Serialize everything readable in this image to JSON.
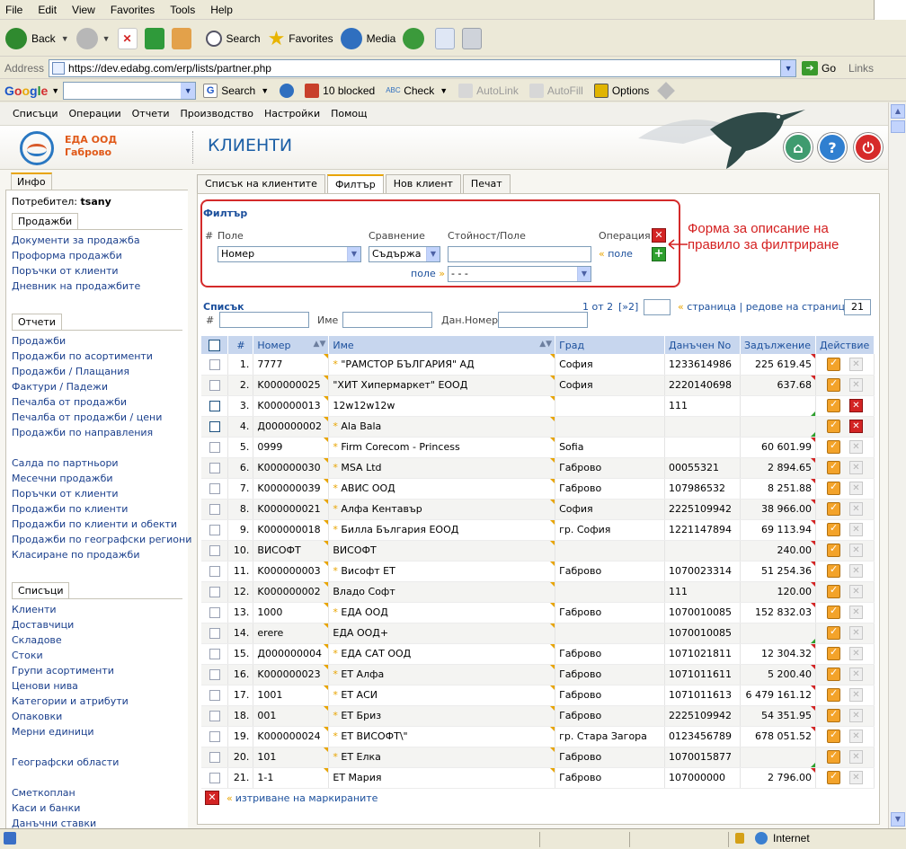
{
  "browser": {
    "menu": [
      "File",
      "Edit",
      "View",
      "Favorites",
      "Tools",
      "Help"
    ],
    "toolbar": {
      "back": "Back",
      "search": "Search",
      "favorites": "Favorites",
      "media": "Media"
    },
    "address": {
      "label": "Address",
      "url": "https://dev.edabg.com/erp/lists/partner.php",
      "go": "Go",
      "links": "Links"
    },
    "googlebar": {
      "search": "Search",
      "blocked": "10 blocked",
      "check": "Check",
      "autolink": "AutoLink",
      "autofill": "AutoFill",
      "options": "Options"
    },
    "status": {
      "zone": "Internet"
    }
  },
  "app": {
    "menu": [
      "Списъци",
      "Операции",
      "Отчети",
      "Производство",
      "Настройки",
      "Помощ"
    ],
    "company": {
      "line1": "ЕДА ООД",
      "line2": "Габрово"
    },
    "title": "КЛИЕНТИ",
    "header_buttons": {
      "home": "⌂",
      "help": "?",
      "power": "⏻"
    }
  },
  "sidebar": {
    "info_tab": "Инфо",
    "user_label": "Потребител:",
    "user_name": "tsany",
    "sections": [
      {
        "title": "Продажби",
        "links": [
          "Документи за продажба",
          "Проформа продажби",
          "Поръчки от клиенти",
          "Дневник на продажбите"
        ]
      },
      {
        "title": "Отчети",
        "links": [
          "Продажби",
          "Продажби по асортименти",
          "Продажби / Плащания",
          "Фактури / Падежи",
          "Печалба от продажби",
          "Печалба от продажби / цени",
          "Продажби по направления",
          "",
          "Салда по партньори",
          "Месечни продажби",
          "Поръчки от клиенти",
          "Продажби по клиенти",
          "Продажби по клиенти и обекти",
          "Продажби по географски региони",
          "Класиране по продажби"
        ]
      },
      {
        "title": "Списъци",
        "links": [
          "Клиенти",
          "Доставчици",
          "Складове",
          "Стоки",
          "Групи асортименти",
          "Ценови нива",
          "Категории и атрибути",
          "Опаковки",
          "Мерни единици",
          "",
          "Географски области",
          "",
          "Сметкоплан",
          "Каси и банки",
          "Данъчни ставки"
        ]
      }
    ]
  },
  "tabs": [
    "Списък на клиентите",
    "Филтър",
    "Нов клиент",
    "Печат"
  ],
  "filter": {
    "title": "Филтър",
    "col_hash": "#",
    "col_field": "Поле",
    "col_compare": "Сравнение",
    "col_value": "Стойност/Поле",
    "col_operation": "Операция",
    "field_value": "Номер",
    "compare_value": "Съдържа",
    "value_input": "",
    "field_link": "поле",
    "field2_label": "поле",
    "field2_value": "- - -",
    "annotation": "Форма за описание на правило за филтриране"
  },
  "list": {
    "title": "Списък",
    "pager_text": "1 от 2",
    "pager_next": "[»2]",
    "page_input": "",
    "page_link": "страница",
    "rows_link": "редове на страница",
    "rows_value": "21",
    "search": {
      "hash_label": "#",
      "name_label": "Име",
      "tax_label": "Дан.Номер"
    },
    "columns": [
      "#",
      "Номер",
      "Име",
      "Град",
      "Данъчен No",
      "Задължение",
      "Действие"
    ],
    "rows": [
      {
        "n": "1.",
        "number": "7777",
        "star": true,
        "name": "\"РАМСТОР БЪЛГАРИЯ\" АД",
        "city": "София",
        "tax": "1233614986",
        "debt": "225 619.45",
        "del_red": false,
        "blue_cb": false
      },
      {
        "n": "2.",
        "number": "K000000025",
        "star": false,
        "name": "\"ХИТ Хипермаркет\" ЕООД",
        "city": "София",
        "tax": "2220140698",
        "debt": "637.68",
        "del_red": false,
        "blue_cb": false
      },
      {
        "n": "3.",
        "number": "K000000013",
        "star": false,
        "name": "12w12w12w",
        "city": "",
        "tax": "111",
        "debt": "",
        "del_red": true,
        "blue_cb": true
      },
      {
        "n": "4.",
        "number": "Д000000002",
        "star": true,
        "name": "Ala Bala",
        "city": "",
        "tax": "",
        "debt": "",
        "del_red": true,
        "blue_cb": true
      },
      {
        "n": "5.",
        "number": "0999",
        "star": true,
        "name": "Firm Corecom - Princess",
        "city": "Sofia",
        "tax": "",
        "debt": "60 601.99",
        "del_red": false,
        "blue_cb": false
      },
      {
        "n": "6.",
        "number": "K000000030",
        "star": true,
        "name": "MSA Ltd",
        "city": "Габрово",
        "tax": "00055321",
        "debt": "2 894.65",
        "del_red": false,
        "blue_cb": false
      },
      {
        "n": "7.",
        "number": "K000000039",
        "star": true,
        "name": "АВИС ООД",
        "city": "Габрово",
        "tax": "107986532",
        "debt": "8 251.88",
        "del_red": false,
        "blue_cb": false
      },
      {
        "n": "8.",
        "number": "K000000021",
        "star": true,
        "name": "Алфа Кентавър",
        "city": "София",
        "tax": "2225109942",
        "debt": "38 966.00",
        "del_red": false,
        "blue_cb": false
      },
      {
        "n": "9.",
        "number": "K000000018",
        "star": true,
        "name": "Билла България ЕООД",
        "city": "гр. София",
        "tax": "1221147894",
        "debt": "69 113.94",
        "del_red": false,
        "blue_cb": false
      },
      {
        "n": "10.",
        "number": "ВИСОФТ",
        "star": false,
        "name": "ВИСОФТ",
        "city": "",
        "tax": "",
        "debt": "240.00",
        "del_red": false,
        "blue_cb": false
      },
      {
        "n": "11.",
        "number": "K000000003",
        "star": true,
        "name": "Висофт ЕТ",
        "city": "Габрово",
        "tax": "1070023314",
        "debt": "51 254.36",
        "del_red": false,
        "blue_cb": false
      },
      {
        "n": "12.",
        "number": "K000000002",
        "star": false,
        "name": "Владо Софт",
        "city": "",
        "tax": "111",
        "debt": "120.00",
        "del_red": false,
        "blue_cb": false
      },
      {
        "n": "13.",
        "number": "1000",
        "star": true,
        "name": "ЕДА ООД",
        "city": "Габрово",
        "tax": "1070010085",
        "debt": "152 832.03",
        "del_red": false,
        "blue_cb": false
      },
      {
        "n": "14.",
        "number": "erere",
        "star": false,
        "name": "ЕДА ООД+",
        "city": "",
        "tax": "1070010085",
        "debt": "",
        "del_red": false,
        "blue_cb": false
      },
      {
        "n": "15.",
        "number": "Д000000004",
        "star": true,
        "name": "ЕДА САТ ООД",
        "city": "Габрово",
        "tax": "1071021811",
        "debt": "12 304.32",
        "del_red": false,
        "blue_cb": false
      },
      {
        "n": "16.",
        "number": "K000000023",
        "star": true,
        "name": "ЕТ Алфа",
        "city": "Габрово",
        "tax": "1071011611",
        "debt": "5 200.40",
        "del_red": false,
        "blue_cb": false
      },
      {
        "n": "17.",
        "number": "1001",
        "star": true,
        "name": "ЕТ АСИ",
        "city": "Габрово",
        "tax": "1071011613",
        "debt": "6 479 161.12",
        "del_red": false,
        "blue_cb": false
      },
      {
        "n": "18.",
        "number": "001",
        "star": true,
        "name": "ЕТ Бриз",
        "city": "Габрово",
        "tax": "2225109942",
        "debt": "54 351.95",
        "del_red": false,
        "blue_cb": false
      },
      {
        "n": "19.",
        "number": "K000000024",
        "star": true,
        "name": "ЕТ ВИСОФТ\\\"",
        "city": "гр. Стара Загора",
        "tax": "0123456789",
        "debt": "678 051.52",
        "del_red": false,
        "blue_cb": false
      },
      {
        "n": "20.",
        "number": "101",
        "star": true,
        "name": "ЕТ Елка",
        "city": "Габрово",
        "tax": "1070015877",
        "debt": "",
        "del_red": false,
        "blue_cb": false
      },
      {
        "n": "21.",
        "number": "1-1",
        "star": false,
        "name": "ЕТ Мария",
        "city": "Габрово",
        "tax": "107000000",
        "debt": "2 796.00",
        "del_red": false,
        "blue_cb": false
      }
    ],
    "delete_marked": "изтриване на маркираните"
  }
}
